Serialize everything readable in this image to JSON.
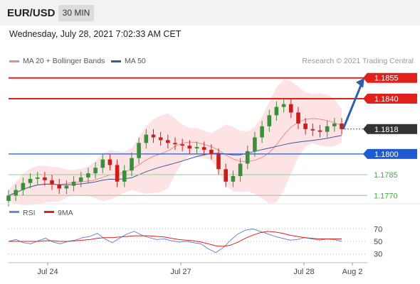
{
  "header": {
    "symbol": "EUR/USD",
    "timeframe": "30 MIN"
  },
  "timestamp": "Wednesday, July 28, 2021 7:02:33 AM CET",
  "legend": {
    "ma20": "MA 20 + Bollinger Bands",
    "ma50": "MA 50",
    "credit": "Research © 2021 Trading Central",
    "rsi": "RSI",
    "rsi_ma": "9MA"
  },
  "colors": {
    "resistance": "#e0201b",
    "support": "#1f5bd0",
    "target": "#3ab03a",
    "bull": "#3a8f3a",
    "bear": "#c81e1e",
    "ma20": "#f08a8a",
    "ma50": "#3a5aa0",
    "bollinger_fill": "#fde3e3",
    "arrow": "#2e5fa8",
    "current_price_bg": "#333333",
    "rsi": "#6b86d6",
    "rsi_ma": "#e0201b"
  },
  "chart_data": [
    {
      "type": "candlestick",
      "title": "",
      "x_tick_labels": [
        "Jul 24",
        "Jul 27",
        "Jul 28",
        "Aug 2"
      ],
      "ylim": [
        1.1765,
        1.186
      ],
      "price_levels": [
        {
          "label": "1.1855",
          "value": 1.1855,
          "role": "resistance"
        },
        {
          "label": "1.1840",
          "value": 1.184,
          "role": "resistance"
        },
        {
          "label": "1.1818",
          "value": 1.1818,
          "role": "current"
        },
        {
          "label": "1.1800",
          "value": 1.18,
          "role": "support"
        },
        {
          "label": "1.1785",
          "value": 1.1785,
          "role": "target"
        },
        {
          "label": "1.1770",
          "value": 1.177,
          "role": "target"
        }
      ],
      "forecast_arrow": {
        "from": 1.1818,
        "to": 1.1855,
        "direction": "up"
      },
      "ohlc_closes_approx": [
        1.177,
        1.1774,
        1.1779,
        1.1782,
        1.1783,
        1.1781,
        1.1778,
        1.1775,
        1.1777,
        1.178,
        1.1783,
        1.1786,
        1.179,
        1.1796,
        1.1792,
        1.178,
        1.1788,
        1.1797,
        1.1808,
        1.1814,
        1.1812,
        1.181,
        1.1808,
        1.1807,
        1.1806,
        1.1804,
        1.1805,
        1.1803,
        1.18,
        1.1789,
        1.178,
        1.1784,
        1.1793,
        1.1802,
        1.1812,
        1.182,
        1.1828,
        1.1834,
        1.1836,
        1.183,
        1.1822,
        1.1818,
        1.1817,
        1.1816,
        1.182,
        1.1822,
        1.1818
      ]
    },
    {
      "type": "line",
      "title": "RSI",
      "y_tick_labels": [
        "70",
        "50",
        "30"
      ],
      "ylim": [
        25,
        75
      ],
      "series": [
        {
          "name": "RSI",
          "values": [
            50,
            53,
            48,
            46,
            51,
            55,
            49,
            46,
            50,
            52,
            56,
            58,
            63,
            54,
            48,
            55,
            62,
            66,
            60,
            56,
            53,
            54,
            51,
            49,
            50,
            48,
            46,
            38,
            32,
            40,
            52,
            62,
            68,
            70,
            66,
            62,
            58,
            55,
            52,
            53,
            56,
            54,
            52,
            54,
            53,
            50
          ]
        },
        {
          "name": "9MA",
          "values": [
            50,
            50,
            50,
            50,
            50,
            51,
            51,
            50,
            50,
            51,
            52,
            53,
            55,
            56,
            56,
            57,
            58,
            59,
            59,
            59,
            58,
            57,
            55,
            53,
            52,
            51,
            49,
            46,
            43,
            42,
            44,
            49,
            55,
            60,
            64,
            66,
            65,
            63,
            60,
            58,
            56,
            55,
            54,
            54,
            54,
            54
          ]
        }
      ]
    }
  ]
}
